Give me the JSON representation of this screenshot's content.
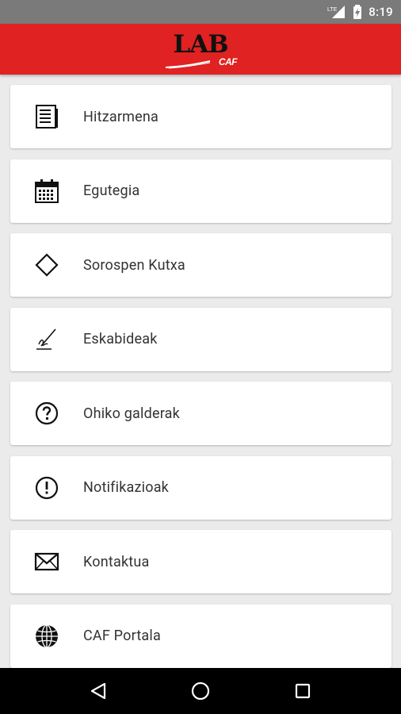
{
  "status_bar": {
    "network": "LTE",
    "time": "8:19"
  },
  "app_bar": {
    "logo_text": "LAB",
    "logo_sub": "CAF",
    "color": "#e02222"
  },
  "menu": {
    "items": [
      {
        "label": "Hitzarmena",
        "icon": "document-icon"
      },
      {
        "label": "Egutegia",
        "icon": "calendar-icon"
      },
      {
        "label": "Sorospen Kutxa",
        "icon": "diamond-icon"
      },
      {
        "label": "Eskabideak",
        "icon": "signature-pen-icon"
      },
      {
        "label": "Ohiko galderak",
        "icon": "question-circle-icon"
      },
      {
        "label": "Notifikazioak",
        "icon": "exclamation-circle-icon"
      },
      {
        "label": "Kontaktua",
        "icon": "envelope-icon"
      },
      {
        "label": "CAF Portala",
        "icon": "globe-icon"
      }
    ]
  },
  "nav_bar": {
    "buttons": [
      "back-icon",
      "home-icon",
      "recents-icon"
    ]
  }
}
